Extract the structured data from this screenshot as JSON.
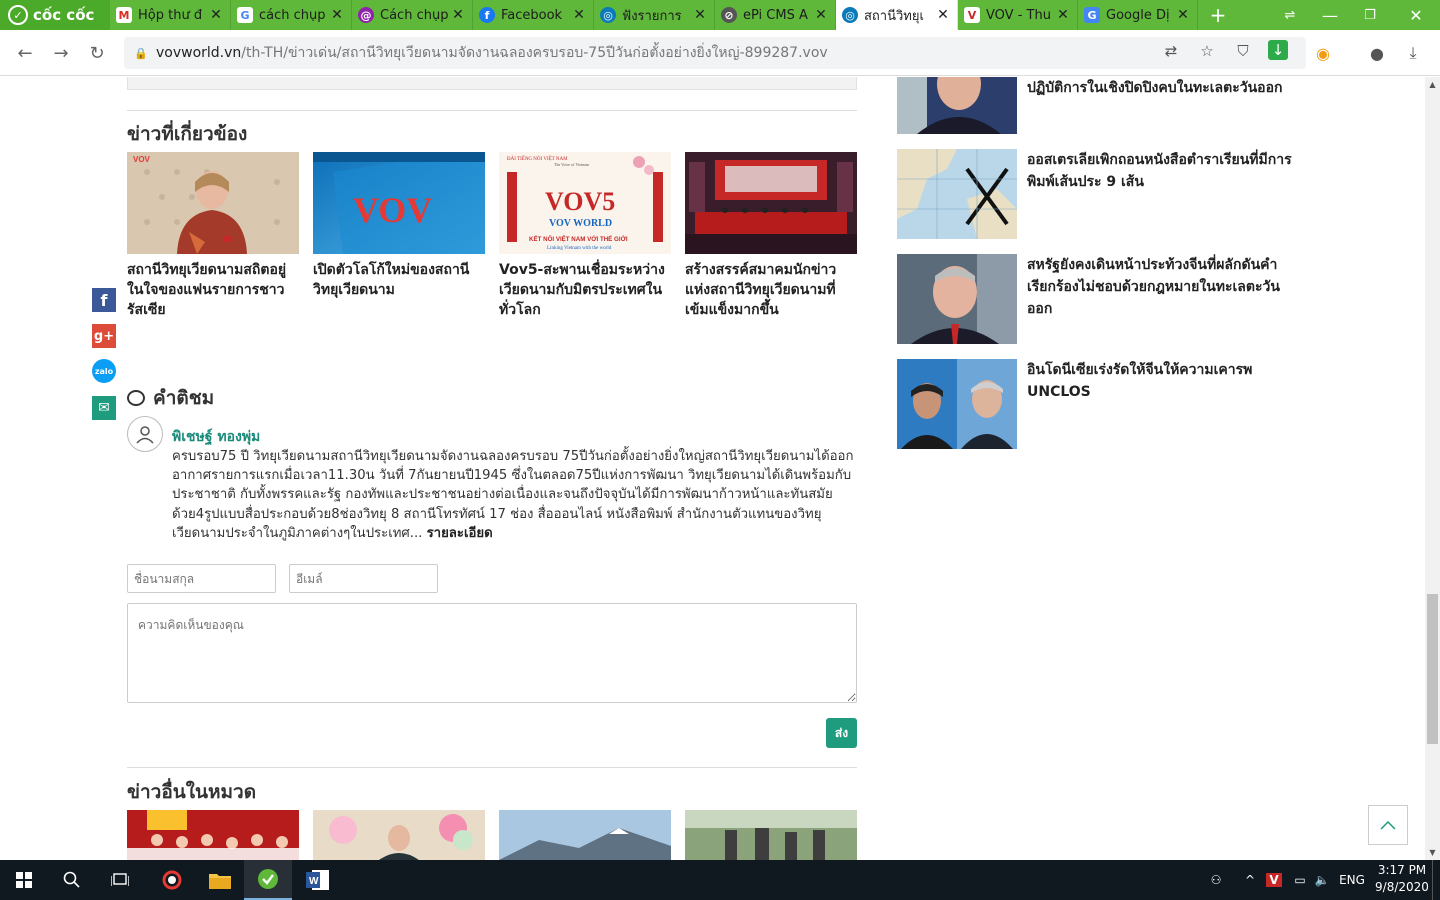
{
  "browser": {
    "brand_label": "cốc cốc",
    "tabs": [
      {
        "label": "Hộp thư đ",
        "icon": "gmail-icon",
        "color": "#d93025",
        "glyph": "M"
      },
      {
        "label": "cách chụp",
        "icon": "google-icon",
        "color": "#4285f4",
        "glyph": "G"
      },
      {
        "label": "Cách chụp",
        "icon": "site-icon",
        "color": "#8e24aa",
        "glyph": "@"
      },
      {
        "label": "Facebook",
        "icon": "facebook-icon",
        "color": "#1877f2",
        "glyph": "f"
      },
      {
        "label": "ฟังรายการ",
        "icon": "vov-icon",
        "color": "#0b7ab8",
        "glyph": "◎"
      },
      {
        "label": "ePi CMS A",
        "icon": "epi-icon",
        "color": "#555555",
        "glyph": "⊘"
      },
      {
        "label": "สถานีวิทยุเ",
        "icon": "vov-icon",
        "color": "#0b7ab8",
        "glyph": "◎"
      },
      {
        "label": "VOV - Thu",
        "icon": "vov-icon",
        "color": "#c62828",
        "glyph": "V"
      },
      {
        "label": "Google Dị",
        "icon": "google-translate-icon",
        "color": "#4285f4",
        "glyph": "G"
      }
    ],
    "url_host": "vovworld.vn",
    "url_path": "/th-TH/ข่าวเด่น/สถานีวิทยุเวียดนามจัดงานฉลองครบรอบ-75ปีวันก่อตั้งอย่างยิ่งใหญ่-899287.vov"
  },
  "related": {
    "title": "ข่าวที่เกี่ยวข้อง",
    "items": [
      {
        "title": "สถานีวิทยุเวียดนามสถิตอยู่ในใจของแฟนรายการชาวรัสเซีย"
      },
      {
        "title": "เปิดตัวโลโก้ใหม่ของสถานีวิทยุเวียดนาม"
      },
      {
        "title": "Vov5-สะพานเชื่อมระหว่างเวียดนามกับมิตรประเทศในทั่วโลก"
      },
      {
        "title": "สร้างสรรค์สมาคมนักข่าวแห่งสถานีวิทยุเวียดนามที่เข้มแข็งมากขึ้น"
      }
    ],
    "thumb_captions": {
      "vov_logo": "VOV",
      "vov5_header": "ĐÀI TIẾNG NÓI VIỆT NAM",
      "vov5_sub": "The Voice of Vietnam",
      "vov5_logo": "VOV5",
      "vov5_world": "VOV WORLD",
      "vov5_slogan": "KẾT NỐI VIỆT NAM VỚI THẾ GIỚI",
      "vov5_slogan_en": "Linking Vietnam with the world"
    }
  },
  "comments": {
    "title": "คำติชม",
    "commenter": "พิเชษฐ์ ทองพุ่ม",
    "text": "ครบรอบ75 ปี วิทยุเวียดนามสถานีวิทยุเวียดนามจัดงานฉลองครบรอบ 75ปีวันก่อตั้งอย่างยิ่งใหญ่สถานีวิทยุเวียดนามได้ออกอากาศรายการแรกเมื่อเวลา11.30น วันที่ 7กันยายนปี1945 ซึ่งในตลอด75ปีแห่งการพัฒนา วิทยุเวียดนามได้เดินพร้อมกับประชาชาติ กับทั้งพรรคและรัฐ กองทัพและประชาชนอย่างต่อเนื่องและจนถึงปัจจุบันได้มีการพัฒนาก้าวหน้าและทันสมัยด้วย4รูปแบบสื่อประกอบด้วย8ช่องวิทยุ 8 สถานีโทรทัศน์ 17 ช่อง สื่อออนไลน์ หนังสือพิมพ์ สำนักงานตัวแทนของวิทยุเวียดนามประจำในภูมิภาคต่างๆในประเทศ...",
    "more": "รายละเอียด"
  },
  "form": {
    "name_placeholder": "ชื่อนามสกุล",
    "email_placeholder": "อีเมล์",
    "comment_placeholder": "ความคิดเห็นของคุณ",
    "send_label": "ส่ง"
  },
  "other": {
    "title": "ข่าวอื่นในหมวด"
  },
  "sidebar": {
    "items": [
      {
        "title": "ปฏิบัติการในเชิงปิดปิงคบในทะเลตะวันออก"
      },
      {
        "title": "ออสเตรเลียเพิกถอนหนังสือตำราเรียนที่มีการพิมพ์เส้นประ 9 เส้น"
      },
      {
        "title": "สหรัฐยังคงเดินหน้าประท้วงจีนที่ผลักดันคำเรียกร้องไม่ชอบด้วยกฎหมายในทะเลตะวันออก"
      },
      {
        "title": "อินโดนีเซียเร่งรัดให้จีนให้ความเคารพ UNCLOS"
      }
    ]
  },
  "taskbar": {
    "lang": "ENG",
    "time": "3:17 PM",
    "date": "9/8/2020"
  },
  "colors": {
    "accent": "#1f9b7e",
    "brand_green": "#5fb83a"
  }
}
